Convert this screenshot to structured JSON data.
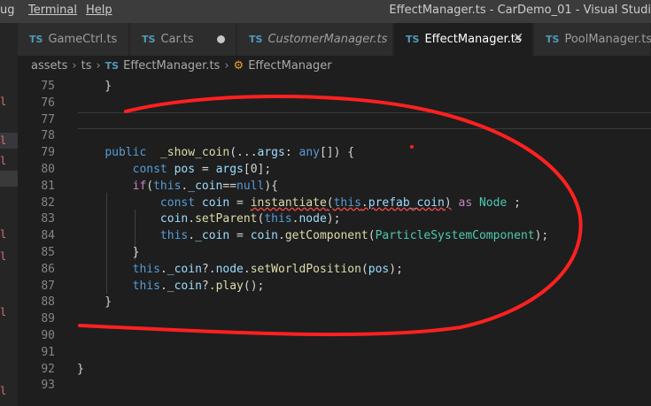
{
  "window": {
    "menu": [
      "ug",
      "Terminal",
      "Help"
    ],
    "title": "EffectManager.ts - CarDemo_01 - Visual Studi"
  },
  "tabs": [
    {
      "icon": "TS",
      "label": "GameCtrl.ts"
    },
    {
      "icon": "TS",
      "label": "Car.ts",
      "modified": true
    },
    {
      "icon": "TS",
      "label": "CustomerManager.ts",
      "italic": true
    },
    {
      "icon": "TS",
      "label": "EffectManager.ts",
      "active": true
    },
    {
      "icon": "TS",
      "label": "PoolManager.ts"
    }
  ],
  "breadcrumb": [
    "assets",
    "ts",
    "EffectManager.ts",
    "EffectManager"
  ],
  "gutter_marks": [
    "l",
    "l",
    "l",
    "l",
    "l",
    "l",
    "l"
  ],
  "editor": {
    "line_numbers": [
      "75",
      "76",
      "77",
      "78",
      "79",
      "80",
      "81",
      "82",
      "83",
      "84",
      "85",
      "86",
      "87",
      "88",
      "89",
      "90",
      "91",
      "92",
      "93"
    ],
    "code_lines": [
      "    }",
      "",
      "",
      "",
      "    public  _show_coin(...args: any[]) {",
      "        const pos = args[0];",
      "        if(this._coin==null){",
      "            const coin = instantiate(this.prefab_coin) as Node ;",
      "            coin.setParent(this.node);",
      "            this._coin = coin.getComponent(ParticleSystemComponent);",
      "        }",
      "        this._coin?.node.setWorldPosition(pos);",
      "        this._coin?.play();",
      "    }",
      "",
      "",
      "",
      "}",
      ""
    ]
  },
  "colors": {
    "keyword": "#569cd6",
    "control": "#c586c0",
    "function": "#dcdcaa",
    "variable": "#9cdcfe",
    "type": "#4ec9b0",
    "annotation": "#ff2020"
  }
}
